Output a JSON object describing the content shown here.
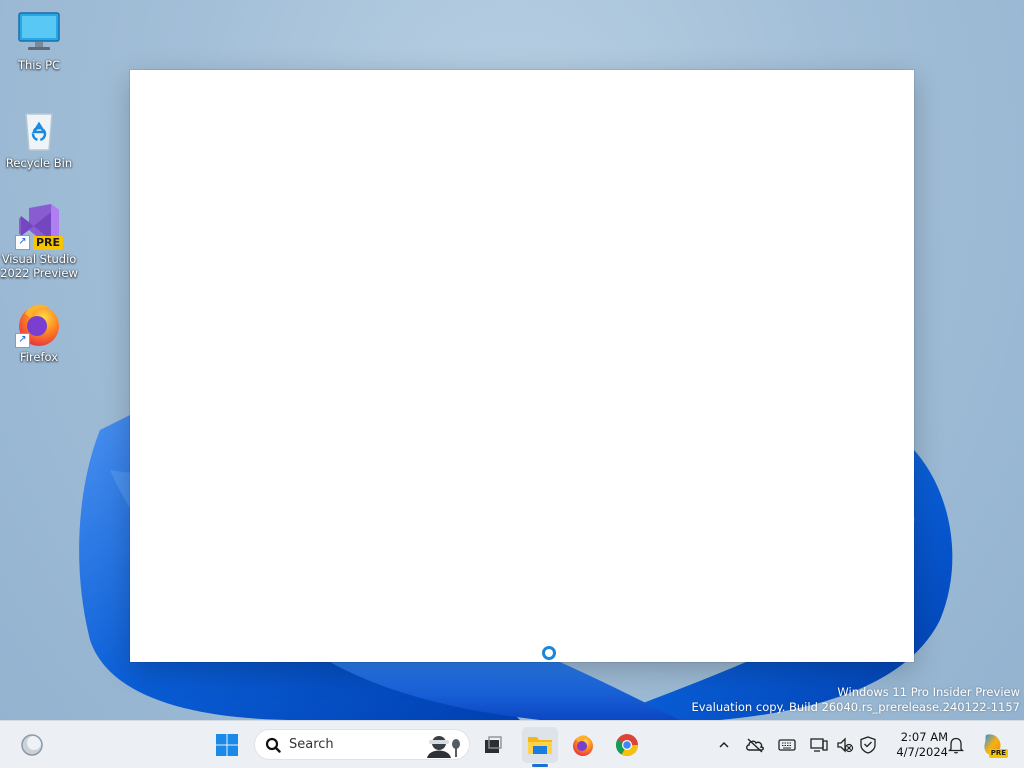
{
  "desktop": {
    "icons": [
      {
        "label": "This PC",
        "icon": "monitor-icon"
      },
      {
        "label": "Recycle Bin",
        "icon": "recycle-bin-icon"
      },
      {
        "label_line1": "Visual Studio",
        "label_line2": "2022 Preview",
        "icon": "visual-studio-preview-icon",
        "badge": "PRE"
      },
      {
        "label": "Firefox",
        "icon": "firefox-icon"
      }
    ]
  },
  "watermark": {
    "line1": "Windows 11 Pro Insider Preview",
    "line2": "Evaluation copy. Build 26040.rs_prerelease.240122-1157"
  },
  "taskbar": {
    "search_placeholder": "Search",
    "pinned": [
      "start-icon",
      "search-icon",
      "task-view-icon",
      "file-explorer-icon",
      "firefox-icon",
      "chrome-icon"
    ],
    "tray": [
      "chevron-up-icon",
      "onedrive-offline-icon",
      "keyboard-icon",
      "network-icon",
      "volume-muted-icon",
      "security-icon"
    ],
    "time": "2:07 AM",
    "date": "4/7/2024",
    "notifications_icon": "bell-icon",
    "copilot_badge": "PRE"
  },
  "colors": {
    "accent": "#1b6fd0",
    "wallpaper_bloom": "#0a5ed7"
  }
}
